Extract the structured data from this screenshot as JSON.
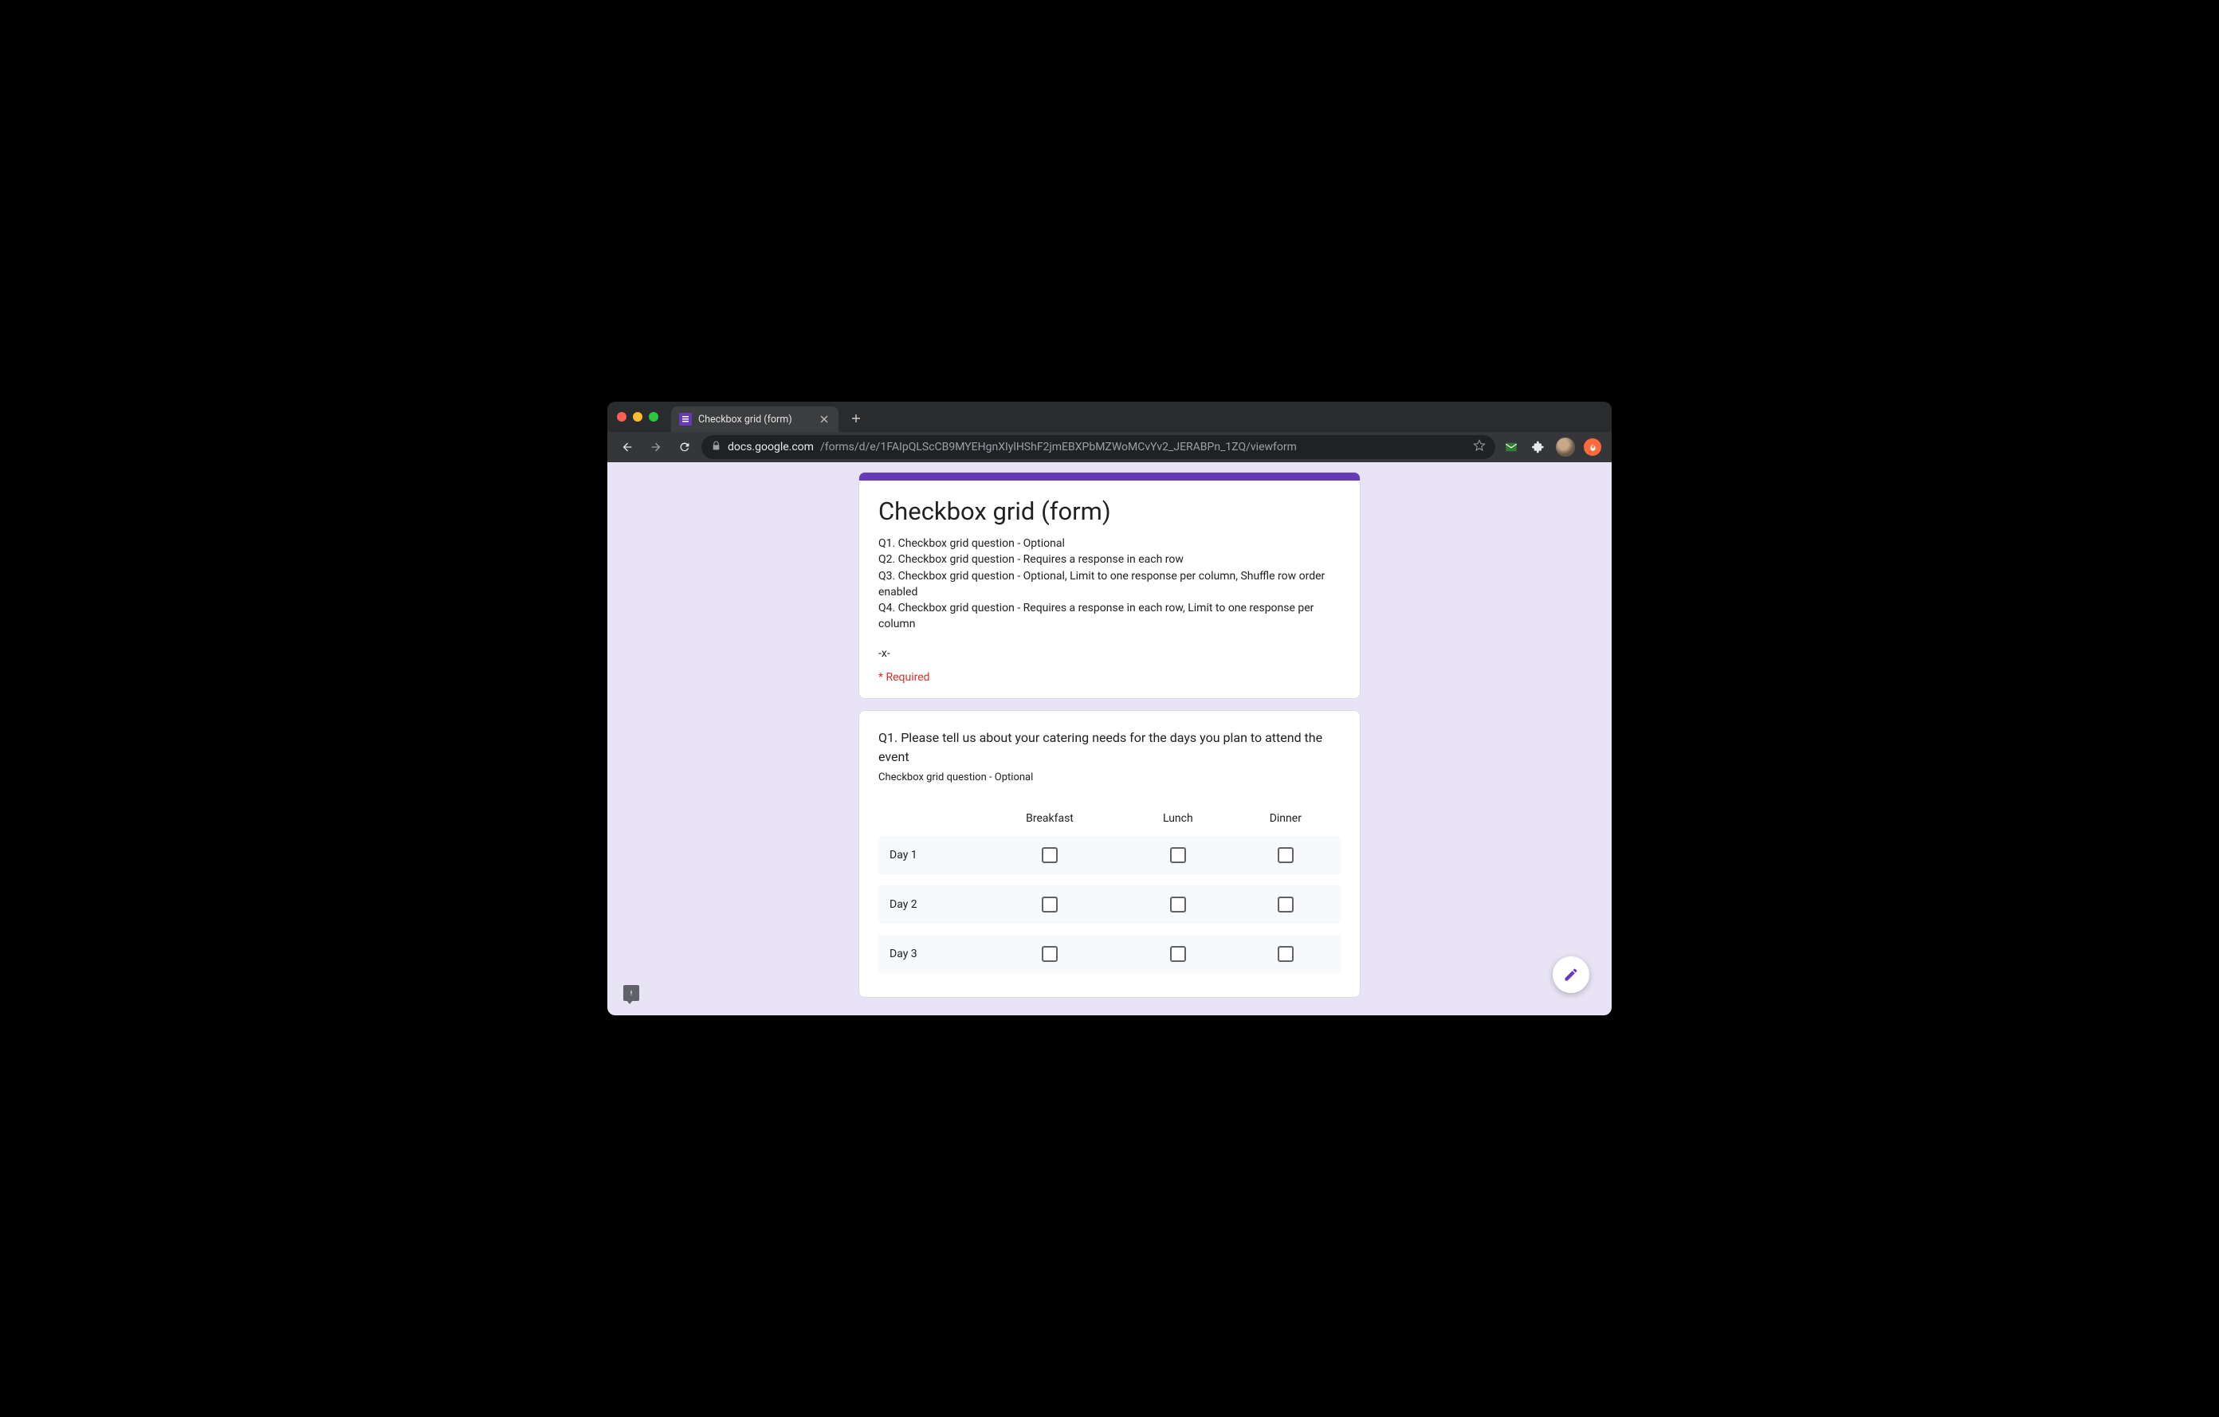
{
  "browser": {
    "tab_title": "Checkbox grid (form)",
    "url_host": "docs.google.com",
    "url_path": "/forms/d/e/1FAIpQLScCB9MYEHgnXIylHShF2jmEBXPbMZWoMCvYv2_JERABPn_1ZQ/viewform"
  },
  "form": {
    "title": "Checkbox grid (form)",
    "description_lines": [
      "Q1. Checkbox grid question - Optional",
      "Q2. Checkbox grid question - Requires a response in each row",
      "Q3. Checkbox grid question - Optional, Limit to one response per column, Shuffle row order enabled",
      "Q4. Checkbox grid question - Requires a response in each row, Limit to one response per column"
    ],
    "separator": "-x-",
    "required_label": "* Required"
  },
  "question": {
    "title": "Q1. Please tell us about your catering needs for the days you plan to attend the event",
    "subtitle": "Checkbox grid question - Optional",
    "columns": [
      "Breakfast",
      "Lunch",
      "Dinner"
    ],
    "rows": [
      "Day 1",
      "Day 2",
      "Day 3"
    ]
  }
}
